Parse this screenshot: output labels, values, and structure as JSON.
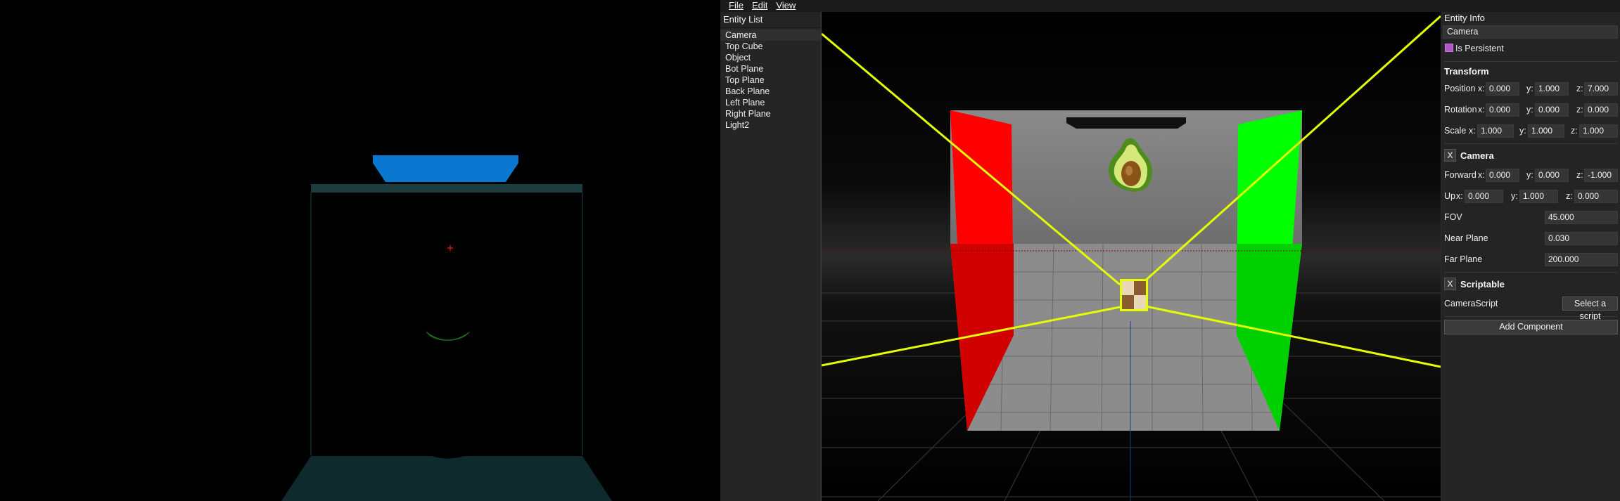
{
  "menu": {
    "file": "File",
    "edit": "Edit",
    "view": "View"
  },
  "entity_list": {
    "title": "Entity List",
    "items": [
      "Camera",
      "Top Cube",
      "Object",
      "Bot Plane",
      "Top Plane",
      "Back Plane",
      "Left Plane",
      "Right Plane",
      "Light2"
    ],
    "selected": "Camera"
  },
  "entity_info": {
    "title": "Entity Info",
    "name": "Camera",
    "is_persistent_label": "Is Persistent",
    "is_persistent": true,
    "transform": {
      "title": "Transform",
      "position": {
        "label": "Position",
        "x": "0.000",
        "y": "1.000",
        "z": "7.000"
      },
      "rotation": {
        "label": "Rotation",
        "x": "0.000",
        "y": "0.000",
        "z": "0.000"
      },
      "scale": {
        "label": "Scale",
        "x": "1.000",
        "y": "1.000",
        "z": "1.000"
      }
    },
    "camera": {
      "remove_label": "X",
      "title": "Camera",
      "forward": {
        "label": "Forward",
        "x": "0.000",
        "y": "0.000",
        "z": "-1.000"
      },
      "up": {
        "label": "Up",
        "x": "0.000",
        "y": "1.000",
        "z": "0.000"
      },
      "fov": {
        "label": "FOV",
        "value": "45.000"
      },
      "near_plane": {
        "label": "Near Plane",
        "value": "0.030"
      },
      "far_plane": {
        "label": "Far Plane",
        "value": "200.000"
      }
    },
    "scriptable": {
      "remove_label": "X",
      "title": "Scriptable",
      "script_label": "CameraScript",
      "select_button": "Select a script"
    },
    "add_component": "Add Component",
    "axis_labels": {
      "x": "x:",
      "y": "y:",
      "z": "z:"
    }
  },
  "colors": {
    "persist_checkbox": "#b256c9",
    "left_wall": "#ff0000",
    "right_wall": "#00ff00",
    "frustum_lines": "#e4ff00",
    "top_cube_game": "#0a78d0",
    "floor_game": "#0f2a2c"
  },
  "icons": {
    "menu_separator": "none"
  }
}
